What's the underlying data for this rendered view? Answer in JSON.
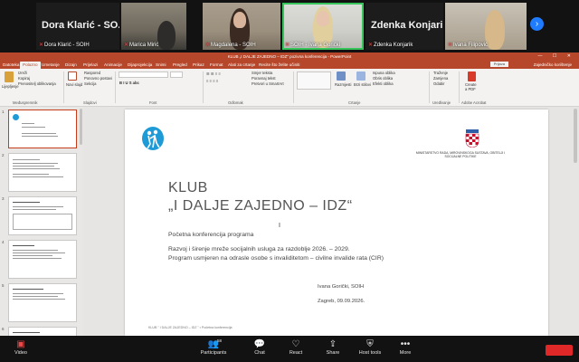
{
  "participants": {
    "tiles": [
      {
        "display_name": "Dora Klarić - SO...",
        "caption": "Dora Klarić - SOIH",
        "muted": true,
        "video": false
      },
      {
        "caption": "Marica Mirić",
        "muted": true,
        "video": true
      },
      {
        "caption": "Magdalena - SOIH",
        "muted": true,
        "video": true
      },
      {
        "caption": "SOIH - Ivana Gorički",
        "muted": true,
        "video": true,
        "active_speaker": true
      },
      {
        "display_name": "Zdenka Konjarik",
        "caption": "Zdenka Konjarik",
        "muted": true,
        "video": false
      },
      {
        "caption": "Ivana Filipović",
        "muted": true,
        "video": true
      }
    ],
    "next_icon": "chevron-right-icon"
  },
  "ppt": {
    "title": "KLUB „I DALJE ZAJEDNO – IDZ\" pozivna konferencija - PowerPoint",
    "menu": [
      "Datoteka",
      "Polazno",
      "Umetanje",
      "Dizajn",
      "Prijelazi",
      "Animacije",
      "Dijaprojekcija",
      "Snimi",
      "Pregled",
      "Prikaz",
      "Format",
      "Alati za crtanje",
      "Recite što želite učiniti"
    ],
    "selected_menu": "Polazno",
    "prijava": "Prijava",
    "share": "Zajedničko korištenje",
    "ribbon": {
      "clipboard": {
        "paste": "Lijepljenje",
        "cut": "Izreži",
        "copy": "Kopiraj",
        "format_painter": "Prenositelj oblikovanja",
        "label": "Međuspremnik"
      },
      "slides": {
        "new": "Novi slajd",
        "layout": "Raspored",
        "reset": "Ponovno postavi",
        "section": "Sekcija",
        "label": "Slajdovi"
      },
      "font_label": "Font",
      "paragraph_label": "Odlomak",
      "paragraph_items": [
        "Smjer teksta",
        "Poravnaj tekst",
        "Pretvori u SmartArt"
      ],
      "drawing_label": "Crtanje",
      "arrange": "Razmjesti",
      "quick_styles": "Brzi stilovi",
      "shape_items": [
        "Ispuna oblika",
        "Obris oblika",
        "Efekti oblika"
      ],
      "editing": {
        "find": "Traženje",
        "replace": "Zamjena",
        "select": "Odabir",
        "label": "Uređivanje"
      },
      "pdf": {
        "label1": "Create",
        "label2": "a PDF",
        "group": "Adobe Acrobat"
      }
    },
    "slide": {
      "klub": "KLUB",
      "name": "„I DALJE ZAJEDNO – IDZ“",
      "p1": "Početna konferencija programa",
      "p2": "Razvoj i širenje mreže socijalnih usluga za razdoblje 2026. – 2029.",
      "p3": "Program usmjeren na odrasle osobe s invaliditetom – civilne invalide rata (CIR)",
      "author": "Ivana Gorički, SOIH",
      "date": "Zagreb, 09.09.2026.",
      "footer": "KLUB \" I DALJE ZAJEDNO – IDZ \"  •  Početna konferencija",
      "ministry": "MINISTARSTVO RADA, MIROVINSKOGA SUSTAVA, OBITELJI I SOCIJALNE POLITIKE",
      "cursor": "I"
    },
    "thumb_numbers": [
      "1",
      "2",
      "3",
      "4",
      "5",
      "6"
    ],
    "brand_colors": {
      "ppt_red": "#b7472a",
      "selection": "#c43e1c",
      "logo_blue": "#1e9bd7",
      "zoom_green": "#37c45a"
    }
  },
  "toolbar": {
    "video": "Video",
    "participants": "Participants",
    "participants_count": "58",
    "chat": "Chat",
    "react": "React",
    "share": "Share",
    "host_tools": "Host tools",
    "more": "More"
  }
}
